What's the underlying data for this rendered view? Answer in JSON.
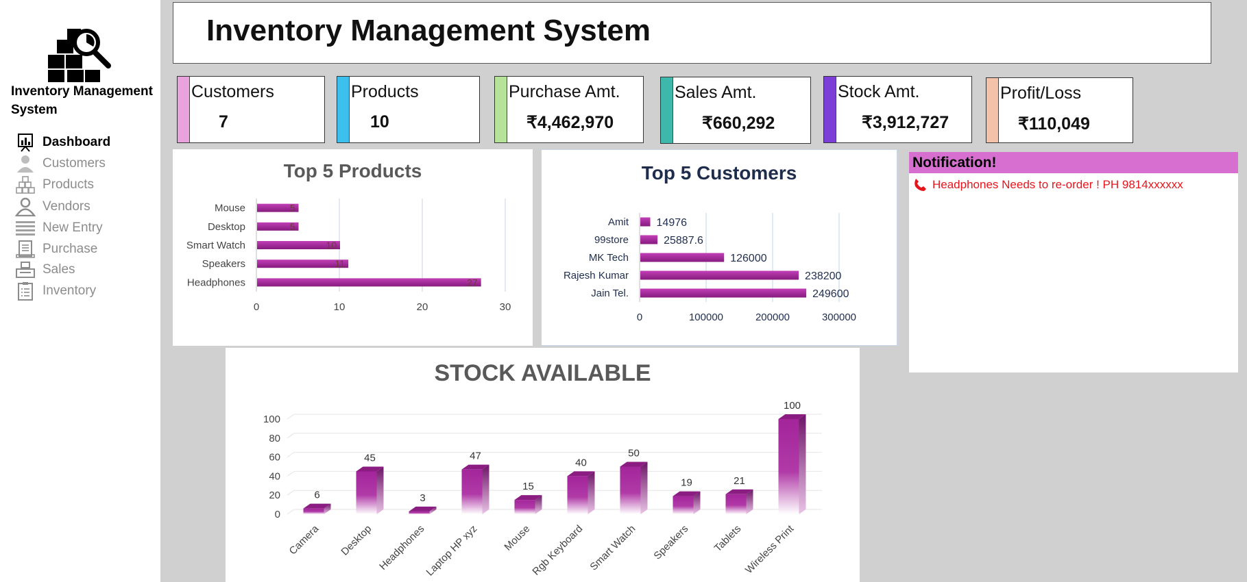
{
  "sidebar": {
    "app_name": "Inventory Management System",
    "items": [
      {
        "label": "Dashboard",
        "icon": "presentation-chart-icon",
        "active": true
      },
      {
        "label": "Customers",
        "icon": "user-icon",
        "active": false
      },
      {
        "label": "Products",
        "icon": "boxes-icon",
        "active": false
      },
      {
        "label": "Vendors",
        "icon": "person-icon",
        "active": false
      },
      {
        "label": "New Entry",
        "icon": "keyboard-icon",
        "active": false
      },
      {
        "label": "Purchase",
        "icon": "receipt-icon",
        "active": false
      },
      {
        "label": "Sales",
        "icon": "cash-register-icon",
        "active": false
      },
      {
        "label": "Inventory",
        "icon": "clipboard-list-icon",
        "active": false
      }
    ]
  },
  "header": {
    "title": "Inventory Management System"
  },
  "kpis": [
    {
      "label": "Customers",
      "value": "7",
      "color": "#e8a3dc"
    },
    {
      "label": "Products",
      "value": "10",
      "color": "#3ec0ef"
    },
    {
      "label": "Purchase Amt.",
      "value": "₹4,462,970",
      "color": "#b5e39a"
    },
    {
      "label": "Sales Amt.",
      "value": "₹660,292",
      "color": "#3fb8ac"
    },
    {
      "label": "Stock Amt.",
      "value": "₹3,912,727",
      "color": "#7b3fd8"
    },
    {
      "label": "Profit/Loss",
      "value": "₹110,049",
      "color": "#f4c2a8"
    }
  ],
  "notification": {
    "title": "Notification!",
    "message": "Headphones  Needs to  re-order  ! PH 9814xxxxxx",
    "icon": "phone-icon"
  },
  "chart_data": [
    {
      "type": "bar",
      "orientation": "horizontal",
      "title": "Top 5  Products",
      "categories": [
        "Mouse",
        "Desktop",
        "Smart Watch",
        "Speakers",
        "Headphones"
      ],
      "values": [
        5,
        5,
        10,
        11,
        27
      ],
      "xlim": [
        0,
        30
      ],
      "ticks": [
        "0",
        "10",
        "20",
        "30"
      ],
      "data_labels": true,
      "grid": true,
      "color": "#a8239a"
    },
    {
      "type": "bar",
      "orientation": "horizontal",
      "title": "Top 5 Customers",
      "categories": [
        "Amit",
        "99store",
        "MK Tech",
        "Rajesh Kumar",
        "Jain Tel."
      ],
      "values": [
        14976,
        25887.6,
        126000,
        238200,
        249600
      ],
      "labels": [
        "14976",
        "25887.6",
        "126000",
        "238200",
        "249600"
      ],
      "xlim": [
        0,
        300000
      ],
      "ticks": [
        "0",
        "100000",
        "200000",
        "300000"
      ],
      "data_labels": true,
      "grid": true,
      "color": "#a8239a"
    },
    {
      "type": "bar",
      "orientation": "vertical",
      "style": "3d-column",
      "title": "STOCK AVAILABLE",
      "categories": [
        "Camera",
        "Desktop",
        "Headphones",
        "Laptop HP xyz",
        "Mouse",
        "Rgb Keyboard",
        "Smart Watch",
        "Speakers",
        "Tablets",
        "Wireless Print"
      ],
      "values": [
        6,
        45,
        3,
        47,
        15,
        40,
        50,
        19,
        21,
        100
      ],
      "ylim": [
        0,
        100
      ],
      "ticks": [
        "0",
        "20",
        "40",
        "60",
        "80",
        "100"
      ],
      "data_labels": true,
      "grid": true,
      "color": "#a8239a"
    }
  ]
}
